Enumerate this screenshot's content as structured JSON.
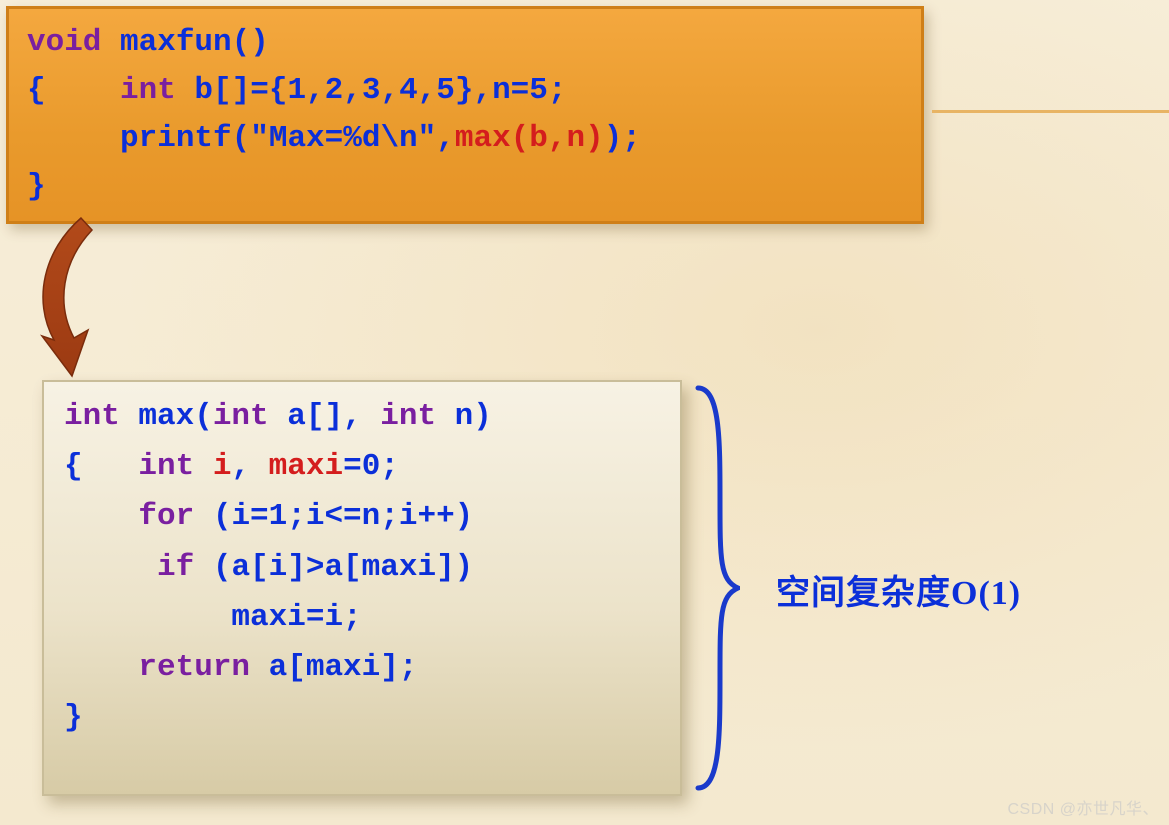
{
  "top": {
    "l1": {
      "a": "void",
      "b": " maxfun()"
    },
    "l2": {
      "a": "{    ",
      "b": "int",
      "c": " b[]={1,2,3,4,5},n=5;"
    },
    "l3": {
      "a": "     printf(\"Max=%d\\n\",",
      "b": "max(b,n)",
      "c": ");"
    },
    "l4": {
      "a": "}"
    }
  },
  "bot": {
    "l1": {
      "a": "int",
      "b": " max(",
      "c": "int",
      "d": " a[], ",
      "e": "int",
      "f": " n)"
    },
    "l2": {
      "a": "{   ",
      "b": "int",
      "c": " ",
      "d": "i",
      "e": ", ",
      "f": "maxi",
      "g": "=0;"
    },
    "l3": {
      "a": "    ",
      "b": "for",
      "c": " (i=1;i<=n;i++)"
    },
    "l4": {
      "a": "     ",
      "b": "if",
      "c": " (a[i]>a[maxi])"
    },
    "l5": {
      "a": "         maxi=i;"
    },
    "l6": {
      "a": "    ",
      "b": "return",
      "c": " a[maxi];"
    },
    "l7": {
      "a": "}"
    }
  },
  "annotation": "空间复杂度O(1)",
  "watermark": "CSDN @亦世凡华、"
}
